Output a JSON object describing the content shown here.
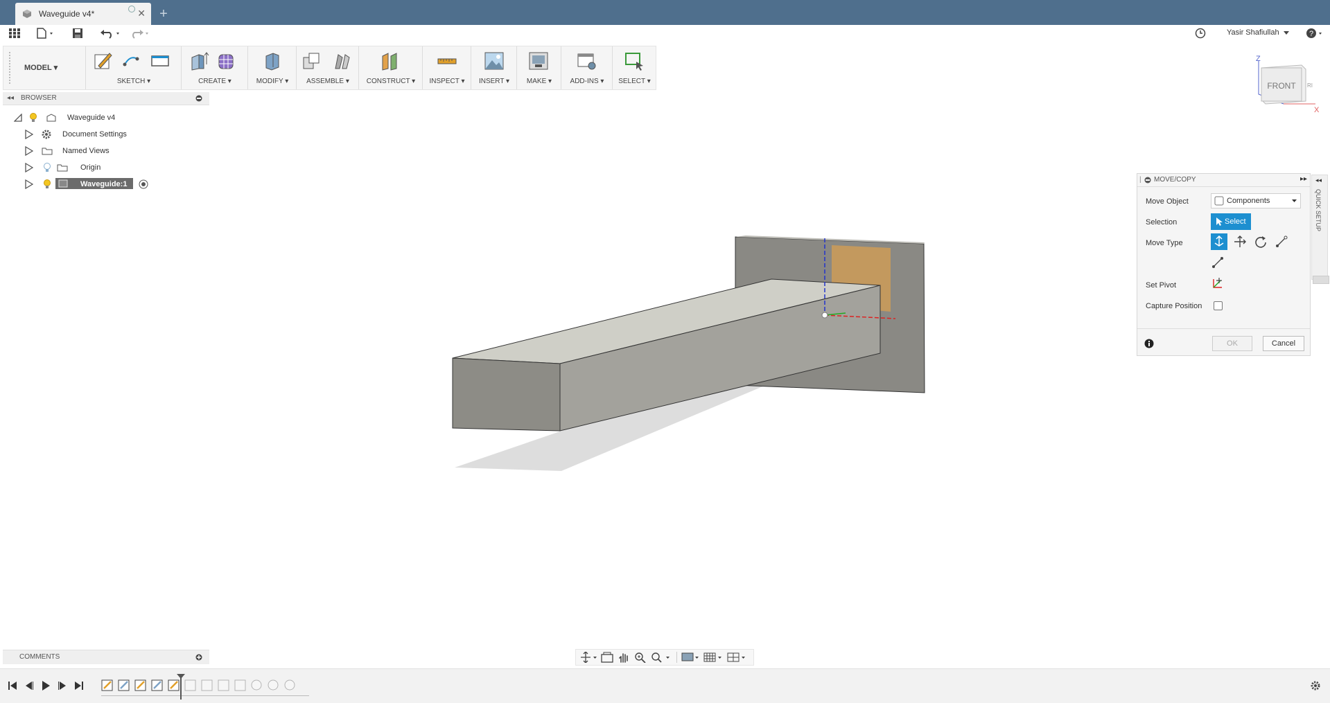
{
  "app": {
    "tab_title": "Waveguide v4*",
    "user_name": "Yasir Shafiullah"
  },
  "toolbar": {
    "workspace": "MODEL",
    "groups": [
      {
        "label": "SKETCH"
      },
      {
        "label": "CREATE"
      },
      {
        "label": "MODIFY"
      },
      {
        "label": "ASSEMBLE"
      },
      {
        "label": "CONSTRUCT"
      },
      {
        "label": "INSPECT"
      },
      {
        "label": "INSERT"
      },
      {
        "label": "MAKE"
      },
      {
        "label": "ADD-INS"
      },
      {
        "label": "SELECT"
      }
    ]
  },
  "browser": {
    "title": "BROWSER",
    "items": [
      {
        "label": "Waveguide v4"
      },
      {
        "label": "Document Settings"
      },
      {
        "label": "Named Views"
      },
      {
        "label": "Origin"
      },
      {
        "label": "Waveguide:1"
      }
    ]
  },
  "viewcube": {
    "face": "FRONT",
    "axis_z": "Z",
    "axis_x": "X"
  },
  "move_copy": {
    "title": "MOVE/COPY",
    "move_object_label": "Move Object",
    "move_object_value": "Components",
    "selection_label": "Selection",
    "select_button": "Select",
    "move_type_label": "Move Type",
    "set_pivot_label": "Set Pivot",
    "capture_position_label": "Capture Position",
    "ok": "OK",
    "cancel": "Cancel"
  },
  "quick_setup": {
    "label": "QUICK SETUP"
  },
  "comments": {
    "title": "COMMENTS"
  },
  "colors": {
    "tab_bar": "#4f6f8d",
    "accent_blue": "#1d8fd0",
    "selected_item": "#6b6b6b"
  }
}
